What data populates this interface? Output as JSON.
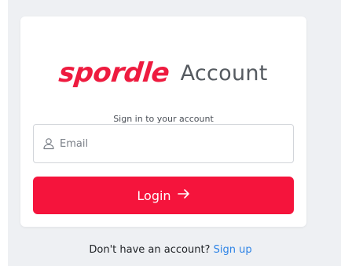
{
  "brand": {
    "logo_text": "spordle",
    "suffix": "Account",
    "logo_color": "#ee1b3f"
  },
  "form": {
    "subtitle": "Sign in to your account",
    "email": {
      "placeholder": "Email",
      "value": "",
      "icon": "user-icon"
    },
    "login_button": {
      "label": "Login",
      "icon": "arrow-right-icon",
      "color": "#f5143c"
    }
  },
  "footer": {
    "prompt": "Don't have an account?",
    "signup_link": "Sign up",
    "link_color": "#2d83e6"
  }
}
